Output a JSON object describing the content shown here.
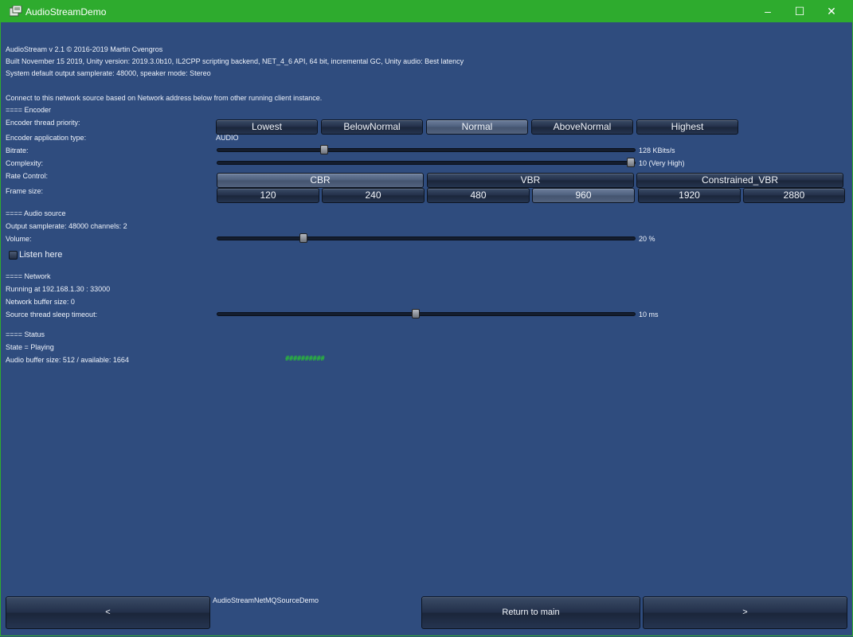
{
  "window": {
    "title": "AudioStreamDemo",
    "minimize": "–",
    "maximize": "☐",
    "close": "✕",
    "accent": "#2eab2e"
  },
  "info": {
    "line1": "AudioStream v 2.1 © 2016-2019 Martin Cvengros",
    "line2": "Built November 15 2019, Unity version: 2019.3.0b10, IL2CPP scripting backend, NET_4_6 API, 64 bit, incremental GC,  Unity audio: Best latency",
    "line3": "System default output samplerate: 48000, speaker mode: Stereo",
    "line4": "Connect to this network source based on Network address below from other running client instance."
  },
  "encoder": {
    "header": "==== Encoder",
    "thread_priority_label": "Encoder thread priority:",
    "priorities": [
      "Lowest",
      "BelowNormal",
      "Normal",
      "AboveNormal",
      "Highest"
    ],
    "priority_selected": "Normal",
    "app_type_label": "Encoder application type:",
    "app_type_value": "AUDIO",
    "bitrate_label": "Bitrate:",
    "bitrate_value": "128 KBits/s",
    "bitrate_fraction": 0.25,
    "complexity_label": "Complexity:",
    "complexity_value": "10 (Very High)",
    "complexity_fraction": 1.0,
    "rate_control_label": "Rate Control:",
    "rate_controls": [
      "CBR",
      "VBR",
      "Constrained_VBR"
    ],
    "rate_control_selected": "CBR",
    "frame_size_label": "Frame size:",
    "frame_sizes": [
      "120",
      "240",
      "480",
      "960",
      "1920",
      "2880"
    ],
    "frame_size_selected": "960"
  },
  "audio_source": {
    "header": "==== Audio source",
    "output_info": "Output samplerate: 48000 channels: 2",
    "volume_label": "Volume:",
    "volume_value": "20 %",
    "volume_fraction": 0.2,
    "listen_label": "Listen here"
  },
  "network": {
    "header": "==== Network",
    "running": "Running at 192.168.1.30 : 33000",
    "buffer_size": "Network buffer size: 0",
    "sleep_label": "Source thread sleep timeout:",
    "sleep_value": "10 ms",
    "sleep_fraction": 0.475
  },
  "status": {
    "header": "==== Status",
    "state": "State = Playing",
    "audio_buffer": "Audio buffer size: 512 / available: 1664",
    "buffer_indicator": "##########",
    "indicator_color": "#29d629"
  },
  "footer": {
    "scene_name": "AudioStreamNetMQSourceDemo",
    "prev_label": "<",
    "main_label": "Return to main",
    "next_label": ">"
  }
}
